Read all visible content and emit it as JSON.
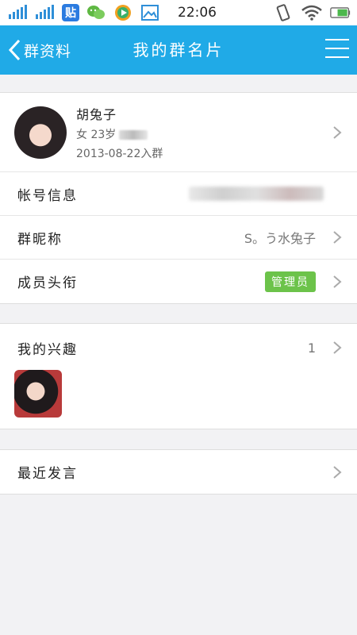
{
  "status_bar": {
    "time": "22:06",
    "tieba_label": "贴"
  },
  "nav": {
    "back_label": "群资料",
    "title": "我的群名片"
  },
  "profile": {
    "name": "胡兔子",
    "gender_age": "女 23岁",
    "join_date": "2013-08-22入群"
  },
  "rows": {
    "account_label": "帐号信息",
    "nickname_label": "群昵称",
    "nickname_value": "S。う水兔子",
    "title_label": "成员头衔",
    "title_badge": "管理员"
  },
  "interest": {
    "label": "我的兴趣",
    "count": "1"
  },
  "recent": {
    "label": "最近发言"
  },
  "colors": {
    "nav_bg": "#20aae7",
    "badge_bg": "#6cc34a"
  }
}
